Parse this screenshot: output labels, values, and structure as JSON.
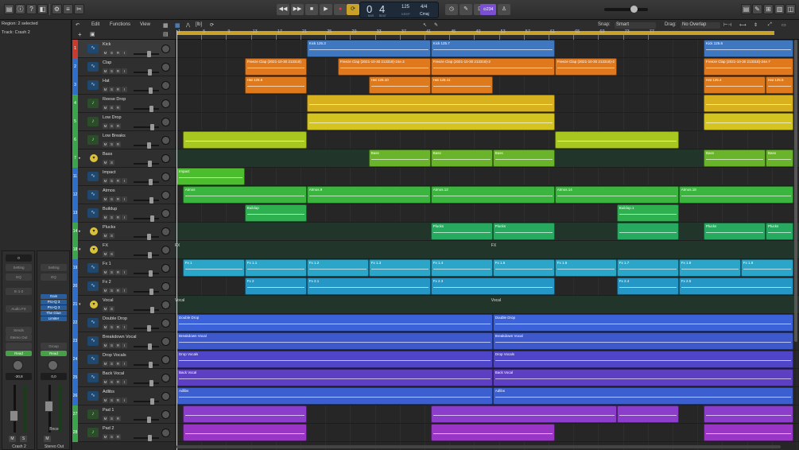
{
  "inspector": {
    "region_label": "Region: 2 selected",
    "track_label": "Track: Crash 2",
    "strip1": {
      "gain": "0",
      "setting": "Setting",
      "eq": "EQ",
      "input": "In 1-2",
      "audio_fx": "Audio FX",
      "plugins": [],
      "send": "Sends",
      "output": "Stereo Out",
      "automation": "Read",
      "volume": "-30,8",
      "mute": "M",
      "solo": "S",
      "name": "Crash 2"
    },
    "strip2": {
      "gain": "",
      "setting": "Setting",
      "eq": "EQ",
      "input": "",
      "audio_fx": "",
      "plugins": [
        "Gain",
        "Pro-Q 3",
        "Pro-Q 3",
        "The Glue",
        "Limiter"
      ],
      "send": "Group",
      "output": "",
      "automation": "Read",
      "volume": "0,0",
      "mute": "M",
      "solo": "",
      "name": "Stereo Out",
      "bounce": "Bnce"
    }
  },
  "transport": {
    "bar": "0",
    "beat": "4",
    "bar_label": "BAR",
    "beat_label": "BEAT",
    "tempo": "125",
    "tempo_label": "KEEP",
    "signature": "4/4",
    "key": "Cmaj",
    "count_in": "⊙234"
  },
  "tracks_header": {
    "edit": "Edit",
    "functions": "Functions",
    "view": "View",
    "snap_label": "Snap:",
    "snap_value": "Smart",
    "drag_label": "Drag:",
    "drag_value": "No Overlap"
  },
  "ruler_bars": [
    "1",
    "5",
    "9",
    "13",
    "17",
    "21",
    "25",
    "29",
    "33",
    "37",
    "41",
    "45",
    "49",
    "53",
    "57",
    "61",
    "65",
    "69",
    "73",
    "77"
  ],
  "tracks": [
    {
      "num": "1",
      "name": "Kick",
      "color": "#c93b2f",
      "icon": "waveform-icon",
      "kind": "audio"
    },
    {
      "num": "2",
      "name": "Clap",
      "color": "#2f6fc9",
      "icon": "waveform-icon",
      "kind": "audio"
    },
    {
      "num": "3",
      "name": "Hat",
      "color": "#2f6fc9",
      "icon": "waveform-icon",
      "kind": "audio"
    },
    {
      "num": "4",
      "name": "Reese Drop",
      "color": "#3aa54a",
      "icon": "music-note-icon",
      "kind": "midi"
    },
    {
      "num": "5",
      "name": "Low Drop",
      "color": "#3aa54a",
      "icon": "music-note-icon",
      "kind": "midi"
    },
    {
      "num": "6",
      "name": "Low Breaks",
      "color": "#3aa54a",
      "icon": "music-note-icon",
      "kind": "midi"
    },
    {
      "num": "7",
      "name": "Bass",
      "color": "#3aa54a",
      "icon": "folder-icon",
      "kind": "folder",
      "disclosure": "▸"
    },
    {
      "num": "11",
      "name": "Impact",
      "color": "#2f6fc9",
      "icon": "waveform-icon",
      "kind": "audio"
    },
    {
      "num": "12",
      "name": "Atmos",
      "color": "#2f6fc9",
      "icon": "waveform-icon",
      "kind": "audio"
    },
    {
      "num": "13",
      "name": "Buildup",
      "color": "#2f6fc9",
      "icon": "waveform-icon",
      "kind": "audio"
    },
    {
      "num": "14",
      "name": "Plucks",
      "color": "#3aa54a",
      "icon": "folder-icon",
      "kind": "folder",
      "disclosure": "▸"
    },
    {
      "num": "18",
      "name": "FX",
      "color": "#3aa54a",
      "icon": "folder-icon",
      "kind": "folder",
      "disclosure": "▾"
    },
    {
      "num": "19",
      "name": "Fx 1",
      "color": "#2f6fc9",
      "icon": "waveform-icon",
      "kind": "audio"
    },
    {
      "num": "20",
      "name": "Fx 2",
      "color": "#2f6fc9",
      "icon": "waveform-icon",
      "kind": "audio"
    },
    {
      "num": "21",
      "name": "Vocal",
      "color": "#2f6fc9",
      "icon": "folder-icon",
      "kind": "folder",
      "disclosure": "▾"
    },
    {
      "num": "22",
      "name": "Double Drop",
      "color": "#2f6fc9",
      "icon": "waveform-icon",
      "kind": "audio"
    },
    {
      "num": "23",
      "name": "Breakdown Vocal",
      "color": "#2f6fc9",
      "icon": "waveform-icon",
      "kind": "audio"
    },
    {
      "num": "24",
      "name": "Drop Vocals",
      "color": "#2f6fc9",
      "icon": "waveform-icon",
      "kind": "audio"
    },
    {
      "num": "25",
      "name": "Back Vocal",
      "color": "#2f6fc9",
      "icon": "waveform-icon",
      "kind": "audio"
    },
    {
      "num": "26",
      "name": "Adlibs",
      "color": "#2f6fc9",
      "icon": "waveform-icon",
      "kind": "audio"
    },
    {
      "num": "27",
      "name": "Pad 1",
      "color": "#3aa54a",
      "icon": "music-note-icon",
      "kind": "midi"
    },
    {
      "num": "28",
      "name": "Pad 2",
      "color": "#3aa54a",
      "icon": "music-note-icon",
      "kind": "midi"
    }
  ],
  "track_button_labels": {
    "mute": "M",
    "solo": "S",
    "record": "R",
    "input": "I"
  },
  "regions": [
    {
      "lane": 0,
      "start": 21,
      "end": 41,
      "color": "#3f78c0",
      "name": "Kick 125.3"
    },
    {
      "lane": 0,
      "start": 41,
      "end": 61,
      "color": "#3f78c0",
      "name": "Kick 125.7"
    },
    {
      "lane": 0,
      "start": 85,
      "end": 105,
      "color": "#3f78c0",
      "name": "Kick 125.6"
    },
    {
      "lane": 1,
      "start": 11,
      "end": 21,
      "color": "#e0781e",
      "name": "Freeze Clap (2021-10-30 213318)"
    },
    {
      "lane": 1,
      "start": 26,
      "end": 41,
      "color": "#e0781e",
      "name": "Freeze Clap (2021-10-30 213318)-24e.3"
    },
    {
      "lane": 1,
      "start": 41,
      "end": 61,
      "color": "#e0781e",
      "name": "Freeze Clap (2021-10-30 213318)-2"
    },
    {
      "lane": 1,
      "start": 61,
      "end": 71,
      "color": "#e0781e",
      "name": "Freeze Clap (2021-10-30 213318)-2"
    },
    {
      "lane": 1,
      "start": 85,
      "end": 105,
      "color": "#e0781e",
      "name": "Freeze Clap (2021-10-30 213318)-24e.7"
    },
    {
      "lane": 2,
      "start": 11,
      "end": 21,
      "color": "#df7a1c",
      "name": "Hat 125.8"
    },
    {
      "lane": 2,
      "start": 31,
      "end": 41,
      "color": "#df7a1c",
      "name": "Hat 125.10"
    },
    {
      "lane": 2,
      "start": 41,
      "end": 51,
      "color": "#df7a1c",
      "name": "Hat 125.11"
    },
    {
      "lane": 2,
      "start": 85,
      "end": 95,
      "color": "#df7a1c",
      "name": "Hat 125.4"
    },
    {
      "lane": 2,
      "start": 95,
      "end": 105,
      "color": "#df7a1c",
      "name": "Hat 125.5"
    },
    {
      "lane": 3,
      "start": 21,
      "end": 61,
      "color": "#d8b11e",
      "name": ""
    },
    {
      "lane": 3,
      "start": 85,
      "end": 105,
      "color": "#d8b11e",
      "name": ""
    },
    {
      "lane": 4,
      "start": 21,
      "end": 61,
      "color": "#d3c41f",
      "name": ""
    },
    {
      "lane": 4,
      "start": 85,
      "end": 105,
      "color": "#d3c41f",
      "name": ""
    },
    {
      "lane": 5,
      "start": 1,
      "end": 21,
      "color": "#a8c820",
      "name": ""
    },
    {
      "lane": 5,
      "start": 61,
      "end": 81,
      "color": "#a8c820",
      "name": ""
    },
    {
      "lane": 6,
      "start": 31,
      "end": 41,
      "color": "#69b42a",
      "name": "Bass"
    },
    {
      "lane": 6,
      "start": 41,
      "end": 51,
      "color": "#69b42a",
      "name": "Bass"
    },
    {
      "lane": 6,
      "start": 51,
      "end": 61,
      "color": "#69b42a",
      "name": "Bass"
    },
    {
      "lane": 6,
      "start": 85,
      "end": 95,
      "color": "#69b42a",
      "name": "Bass"
    },
    {
      "lane": 6,
      "start": 95,
      "end": 105,
      "color": "#69b42a",
      "name": "Bass"
    },
    {
      "lane": 7,
      "start": 0,
      "end": 11,
      "color": "#4cbe2d",
      "name": "Impact"
    },
    {
      "lane": 7,
      "start": 105,
      "end": 114,
      "color": "#4cbe2d",
      "name": "Impact 1"
    },
    {
      "lane": 8,
      "start": 1,
      "end": 21,
      "color": "#3ab53d",
      "name": "Atmos"
    },
    {
      "lane": 8,
      "start": 21,
      "end": 41,
      "color": "#3ab53d",
      "name": "Atmos.9"
    },
    {
      "lane": 8,
      "start": 41,
      "end": 61,
      "color": "#3ab53d",
      "name": "Atmos.12"
    },
    {
      "lane": 8,
      "start": 61,
      "end": 81,
      "color": "#3ab53d",
      "name": "Atmos.14"
    },
    {
      "lane": 8,
      "start": 81,
      "end": 105,
      "color": "#3ab53d",
      "name": "Atmos.18"
    },
    {
      "lane": 9,
      "start": 11,
      "end": 21,
      "color": "#2fb050",
      "name": "Buildup"
    },
    {
      "lane": 9,
      "start": 71,
      "end": 81,
      "color": "#2fb050",
      "name": "Buildup.1"
    },
    {
      "lane": 10,
      "start": 41,
      "end": 51,
      "color": "#26aa60",
      "name": "Plucks"
    },
    {
      "lane": 10,
      "start": 51,
      "end": 61,
      "color": "#26aa60",
      "name": "Plucks"
    },
    {
      "lane": 10,
      "start": 71,
      "end": 81,
      "color": "#26aa60",
      "name": ""
    },
    {
      "lane": 10,
      "start": 85,
      "end": 95,
      "color": "#26aa60",
      "name": "Plucks"
    },
    {
      "lane": 10,
      "start": 95,
      "end": 105,
      "color": "#26aa60",
      "name": "Plucks"
    },
    {
      "lane": 12,
      "start": 1,
      "end": 11,
      "color": "#2ba6c9",
      "name": "Fx 1"
    },
    {
      "lane": 12,
      "start": 11,
      "end": 21,
      "color": "#2ba6c9",
      "name": "Fx 1.1"
    },
    {
      "lane": 12,
      "start": 21,
      "end": 31,
      "color": "#2ba6c9",
      "name": "Fx 1.2"
    },
    {
      "lane": 12,
      "start": 31,
      "end": 41,
      "color": "#2ba6c9",
      "name": "Fx 1.3"
    },
    {
      "lane": 12,
      "start": 41,
      "end": 51,
      "color": "#2ba6c9",
      "name": "Fx 1.4"
    },
    {
      "lane": 12,
      "start": 51,
      "end": 61,
      "color": "#2ba6c9",
      "name": "Fx 1.5"
    },
    {
      "lane": 12,
      "start": 61,
      "end": 71,
      "color": "#2ba6c9",
      "name": "Fx 1.6"
    },
    {
      "lane": 12,
      "start": 71,
      "end": 81,
      "color": "#2ba6c9",
      "name": "Fx 1.7"
    },
    {
      "lane": 12,
      "start": 81,
      "end": 91,
      "color": "#2ba6c9",
      "name": "Fx 1.8"
    },
    {
      "lane": 12,
      "start": 91,
      "end": 101,
      "color": "#2ba6c9",
      "name": "Fx 1.9"
    },
    {
      "lane": 13,
      "start": 11,
      "end": 21,
      "color": "#2497c7",
      "name": "Fx 2"
    },
    {
      "lane": 13,
      "start": 21,
      "end": 41,
      "color": "#2497c7",
      "name": "Fx 2.1"
    },
    {
      "lane": 13,
      "start": 41,
      "end": 61,
      "color": "#2497c7",
      "name": "Fx 2.3"
    },
    {
      "lane": 13,
      "start": 71,
      "end": 81,
      "color": "#2497c7",
      "name": "Fx 2.4"
    },
    {
      "lane": 13,
      "start": 81,
      "end": 101,
      "color": "#2497c7",
      "name": "Fx 2.5"
    },
    {
      "lane": 15,
      "start": 0,
      "end": 51,
      "color": "#3b62d8",
      "name": "Double Drop"
    },
    {
      "lane": 15,
      "start": 51,
      "end": 110,
      "color": "#3b62d8",
      "name": "Double Drop"
    },
    {
      "lane": 16,
      "start": 0,
      "end": 51,
      "color": "#3e59cc",
      "name": "Breakdown Vocal"
    },
    {
      "lane": 16,
      "start": 51,
      "end": 110,
      "color": "#3e59cc",
      "name": "Breakdown Vocal"
    },
    {
      "lane": 17,
      "start": 0,
      "end": 51,
      "color": "#4f45c8",
      "name": "Drop Vocals"
    },
    {
      "lane": 17,
      "start": 51,
      "end": 110,
      "color": "#4f45c8",
      "name": "Drop Vocals"
    },
    {
      "lane": 18,
      "start": 0,
      "end": 51,
      "color": "#5d3fc4",
      "name": "Back Vocal"
    },
    {
      "lane": 18,
      "start": 51,
      "end": 110,
      "color": "#5d3fc4",
      "name": "Back Vocal"
    },
    {
      "lane": 19,
      "start": 0,
      "end": 51,
      "color": "#3b5fd0",
      "name": "Adlibs"
    },
    {
      "lane": 19,
      "start": 51,
      "end": 110,
      "color": "#3b5fd0",
      "name": "Adlibs"
    },
    {
      "lane": 20,
      "start": 1,
      "end": 21,
      "color": "#8d3dcc",
      "name": ""
    },
    {
      "lane": 20,
      "start": 41,
      "end": 71,
      "color": "#8d3dcc",
      "name": ""
    },
    {
      "lane": 20,
      "start": 71,
      "end": 81,
      "color": "#8d3dcc",
      "name": ""
    },
    {
      "lane": 20,
      "start": 85,
      "end": 105,
      "color": "#8d3dcc",
      "name": ""
    },
    {
      "lane": 21,
      "start": 1,
      "end": 21,
      "color": "#9a36c6",
      "name": ""
    },
    {
      "lane": 21,
      "start": 41,
      "end": 61,
      "color": "#9a36c6",
      "name": ""
    },
    {
      "lane": 21,
      "start": 85,
      "end": 105,
      "color": "#9a36c6",
      "name": ""
    }
  ],
  "folder_labels": [
    {
      "lane": 11,
      "text": "FX"
    },
    {
      "lane": 14,
      "text": "Vocal"
    }
  ],
  "icons": {
    "library": "library-icon",
    "inspector": "inspector-icon",
    "help": "help-icon",
    "smart_controls": "smart-controls-icon",
    "mixer": "mixer-icon",
    "editors": "scissors-icon"
  }
}
